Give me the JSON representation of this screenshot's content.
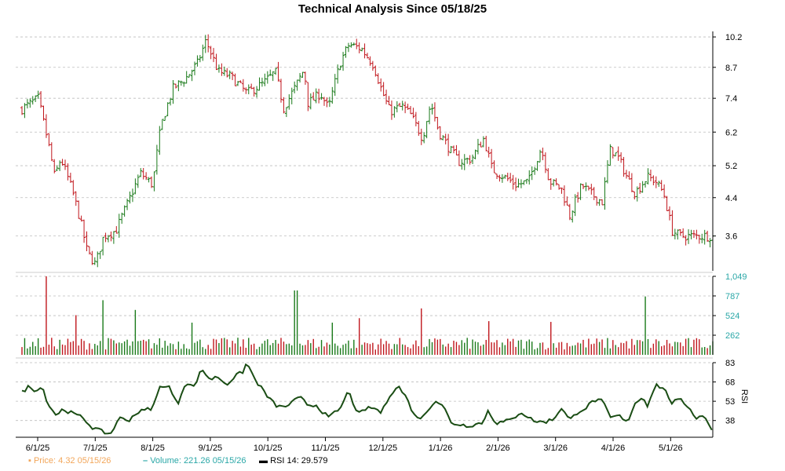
{
  "chart_data": {
    "type": "line",
    "title": "Technical Analysis Since 05/18/25",
    "x_tick_labels": [
      "6/1/25",
      "7/1/25",
      "8/1/25",
      "9/1/25",
      "10/1/25",
      "11/1/25",
      "12/1/25",
      "1/1/26",
      "2/1/26",
      "3/1/26",
      "4/1/26",
      "5/1/26"
    ],
    "price_panel": {
      "y_tick_labels": [
        "10.2",
        "8.7",
        "7.4",
        "6.2",
        "5.2",
        "4.4",
        "3.6"
      ],
      "y_ticks": [
        10.2,
        8.7,
        7.4,
        6.2,
        5.2,
        4.4,
        3.6
      ],
      "ylim": [
        3.0,
        10.5
      ],
      "scale": "log",
      "anchors": [
        [
          0,
          7.0
        ],
        [
          8,
          7.4
        ],
        [
          10,
          6.7
        ],
        [
          16,
          4.9
        ],
        [
          19,
          5.4
        ],
        [
          25,
          4.5
        ],
        [
          32,
          3.3
        ],
        [
          36,
          3.1
        ],
        [
          40,
          3.6
        ],
        [
          46,
          3.7
        ],
        [
          52,
          4.3
        ],
        [
          58,
          5.0
        ],
        [
          64,
          4.7
        ],
        [
          68,
          6.4
        ],
        [
          74,
          7.8
        ],
        [
          80,
          8.2
        ],
        [
          86,
          8.9
        ],
        [
          90,
          10.0
        ],
        [
          96,
          8.5
        ],
        [
          102,
          8.3
        ],
        [
          110,
          7.6
        ],
        [
          118,
          8.0
        ],
        [
          124,
          8.5
        ],
        [
          128,
          7.0
        ],
        [
          134,
          7.9
        ],
        [
          138,
          8.6
        ],
        [
          140,
          7.2
        ],
        [
          146,
          7.6
        ],
        [
          150,
          7.0
        ],
        [
          156,
          9.0
        ],
        [
          160,
          9.8
        ],
        [
          166,
          9.6
        ],
        [
          172,
          8.8
        ],
        [
          176,
          7.7
        ],
        [
          180,
          6.9
        ],
        [
          186,
          7.1
        ],
        [
          190,
          6.8
        ],
        [
          196,
          6.0
        ],
        [
          200,
          7.2
        ],
        [
          204,
          6.2
        ],
        [
          210,
          5.6
        ],
        [
          214,
          5.3
        ],
        [
          220,
          5.4
        ],
        [
          226,
          6.0
        ],
        [
          230,
          5.1
        ],
        [
          236,
          4.9
        ],
        [
          242,
          4.7
        ],
        [
          248,
          4.8
        ],
        [
          254,
          5.7
        ],
        [
          258,
          4.8
        ],
        [
          264,
          4.6
        ],
        [
          268,
          4.0
        ],
        [
          274,
          4.7
        ],
        [
          278,
          4.5
        ],
        [
          284,
          4.3
        ],
        [
          288,
          5.7
        ],
        [
          292,
          5.4
        ],
        [
          296,
          4.9
        ],
        [
          300,
          4.5
        ],
        [
          306,
          4.9
        ],
        [
          310,
          4.8
        ],
        [
          314,
          4.5
        ],
        [
          318,
          3.7
        ],
        [
          322,
          3.6
        ]
      ],
      "first_close": 7.0,
      "last_close": 3.6,
      "bar_count": 257
    },
    "volume_panel": {
      "y_tick_labels": [
        "1,049",
        "787",
        "524",
        "262"
      ],
      "y_ticks": [
        1049,
        787,
        524,
        262
      ],
      "ylim": [
        0,
        1049
      ],
      "typical": 200,
      "spikes": [
        [
          12,
          1049
        ],
        [
          27,
          530
        ],
        [
          39,
          730
        ],
        [
          56,
          600
        ],
        [
          83,
          430
        ],
        [
          134,
          860
        ],
        [
          152,
          430
        ],
        [
          165,
          490
        ],
        [
          196,
          620
        ],
        [
          229,
          450
        ],
        [
          259,
          440
        ],
        [
          305,
          780
        ]
      ]
    },
    "rsi_panel": {
      "label": "RSI",
      "y_tick_labels": [
        "83",
        "68",
        "53",
        "38"
      ],
      "y_ticks": [
        83,
        68,
        53,
        38
      ],
      "ylim": [
        25,
        83
      ],
      "anchors": [
        [
          0,
          60
        ],
        [
          3,
          64
        ],
        [
          6,
          62
        ],
        [
          10,
          64
        ],
        [
          13,
          50
        ],
        [
          17,
          42
        ],
        [
          20,
          47
        ],
        [
          24,
          44
        ],
        [
          30,
          40
        ],
        [
          34,
          33
        ],
        [
          38,
          30
        ],
        [
          42,
          28
        ],
        [
          44,
          28
        ],
        [
          47,
          40
        ],
        [
          52,
          38
        ],
        [
          56,
          44
        ],
        [
          60,
          46
        ],
        [
          64,
          48
        ],
        [
          68,
          66
        ],
        [
          72,
          64
        ],
        [
          76,
          50
        ],
        [
          80,
          68
        ],
        [
          84,
          64
        ],
        [
          88,
          78
        ],
        [
          92,
          70
        ],
        [
          96,
          72
        ],
        [
          100,
          66
        ],
        [
          104,
          72
        ],
        [
          108,
          76
        ],
        [
          110,
          83
        ],
        [
          114,
          70
        ],
        [
          120,
          57
        ],
        [
          124,
          50
        ],
        [
          128,
          48
        ],
        [
          132,
          52
        ],
        [
          136,
          56
        ],
        [
          140,
          50
        ],
        [
          144,
          50
        ],
        [
          150,
          40
        ],
        [
          156,
          48
        ],
        [
          160,
          62
        ],
        [
          164,
          42
        ],
        [
          168,
          47
        ],
        [
          172,
          48
        ],
        [
          176,
          44
        ],
        [
          180,
          58
        ],
        [
          184,
          65
        ],
        [
          188,
          56
        ],
        [
          192,
          42
        ],
        [
          196,
          40
        ],
        [
          202,
          54
        ],
        [
          206,
          50
        ],
        [
          210,
          36
        ],
        [
          214,
          35
        ],
        [
          218,
          34
        ],
        [
          222,
          35
        ],
        [
          226,
          37
        ],
        [
          228,
          46
        ],
        [
          232,
          36
        ],
        [
          236,
          37
        ],
        [
          240,
          39
        ],
        [
          244,
          45
        ],
        [
          248,
          40
        ],
        [
          252,
          37
        ],
        [
          256,
          37
        ],
        [
          260,
          39
        ],
        [
          264,
          48
        ],
        [
          268,
          38
        ],
        [
          272,
          45
        ],
        [
          276,
          48
        ],
        [
          280,
          54
        ],
        [
          284,
          53
        ],
        [
          288,
          40
        ],
        [
          292,
          42
        ],
        [
          296,
          36
        ],
        [
          300,
          52
        ],
        [
          304,
          56
        ],
        [
          306,
          50
        ],
        [
          310,
          66
        ],
        [
          314,
          63
        ],
        [
          318,
          52
        ],
        [
          322,
          54
        ],
        [
          326,
          49
        ],
        [
          330,
          40
        ],
        [
          334,
          42
        ],
        [
          338,
          29.6
        ]
      ]
    },
    "legend": [
      {
        "swatch": "▪",
        "label": "Price: 4.32  05/15/26",
        "color": "#f2a65a"
      },
      {
        "swatch": "–",
        "label": "Volume: 221.26  05/15/26",
        "color": "#2aa7a7"
      },
      {
        "swatch": "▬",
        "label": "RSI 14: 29.579",
        "color": "#000000"
      }
    ],
    "colors": {
      "up": "#1a7a1a",
      "down": "#c0161c",
      "rsi_line": "#1a4d14",
      "grid": "#bdbdbd",
      "axis_volume": "#2aa7a7"
    },
    "grid": true
  }
}
